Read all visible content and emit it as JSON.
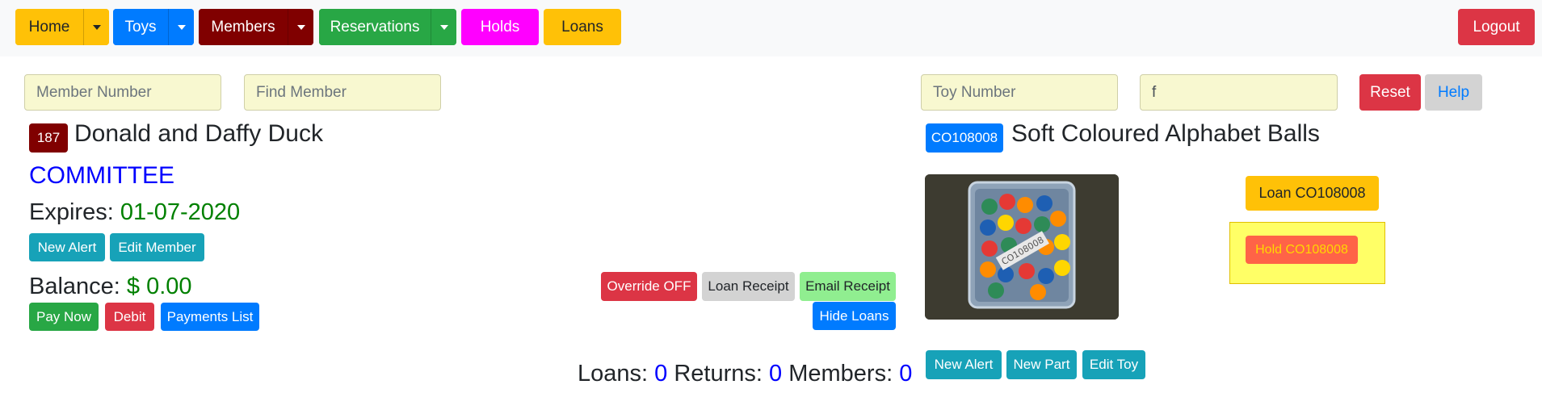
{
  "nav": {
    "home": "Home",
    "toys": "Toys",
    "members": "Members",
    "reservations": "Reservations",
    "holds": "Holds",
    "loans": "Loans",
    "logout": "Logout"
  },
  "search": {
    "member_number_placeholder": "Member Number",
    "find_member_placeholder": "Find Member",
    "toy_number_placeholder": "Toy Number",
    "toy_search_value": "f",
    "reset": "Reset",
    "help": "Help"
  },
  "member": {
    "number": "187",
    "name": "Donald and Daffy Duck",
    "role": "COMMITTEE",
    "expires_label": "Expires:",
    "expires_value": "01-07-2020",
    "new_alert": "New Alert",
    "edit_member": "Edit Member",
    "balance_label": "Balance:",
    "balance_value": "$ 0.00",
    "pay_now": "Pay Now",
    "debit": "Debit",
    "payments_list": "Payments List"
  },
  "actions": {
    "override": "Override OFF",
    "loan_receipt": "Loan Receipt",
    "email_receipt": "Email Receipt",
    "hide_loans": "Hide Loans"
  },
  "totals": {
    "loans_label": "Loans:",
    "loans_value": "0",
    "returns_label": "Returns:",
    "returns_value": "0",
    "members_label": "Members:",
    "members_value": "0"
  },
  "toy": {
    "code": "CO108008",
    "name": "Soft Coloured Alphabet Balls",
    "photo_label": "CO108008",
    "loan_button": "Loan CO108008",
    "hold_button": "Hold CO108008",
    "new_alert": "New Alert",
    "new_part": "New Part",
    "edit_toy": "Edit Toy"
  },
  "colors": {
    "accent_yellow": "#ffc107",
    "primary_blue": "#007bff",
    "members_maroon": "#800000",
    "success_green": "#28a745",
    "holds_magenta": "#ff00ff",
    "danger_red": "#dc3545",
    "info_teal": "#17a2b8",
    "text_blue": "#0000ff",
    "text_green": "#008000"
  }
}
